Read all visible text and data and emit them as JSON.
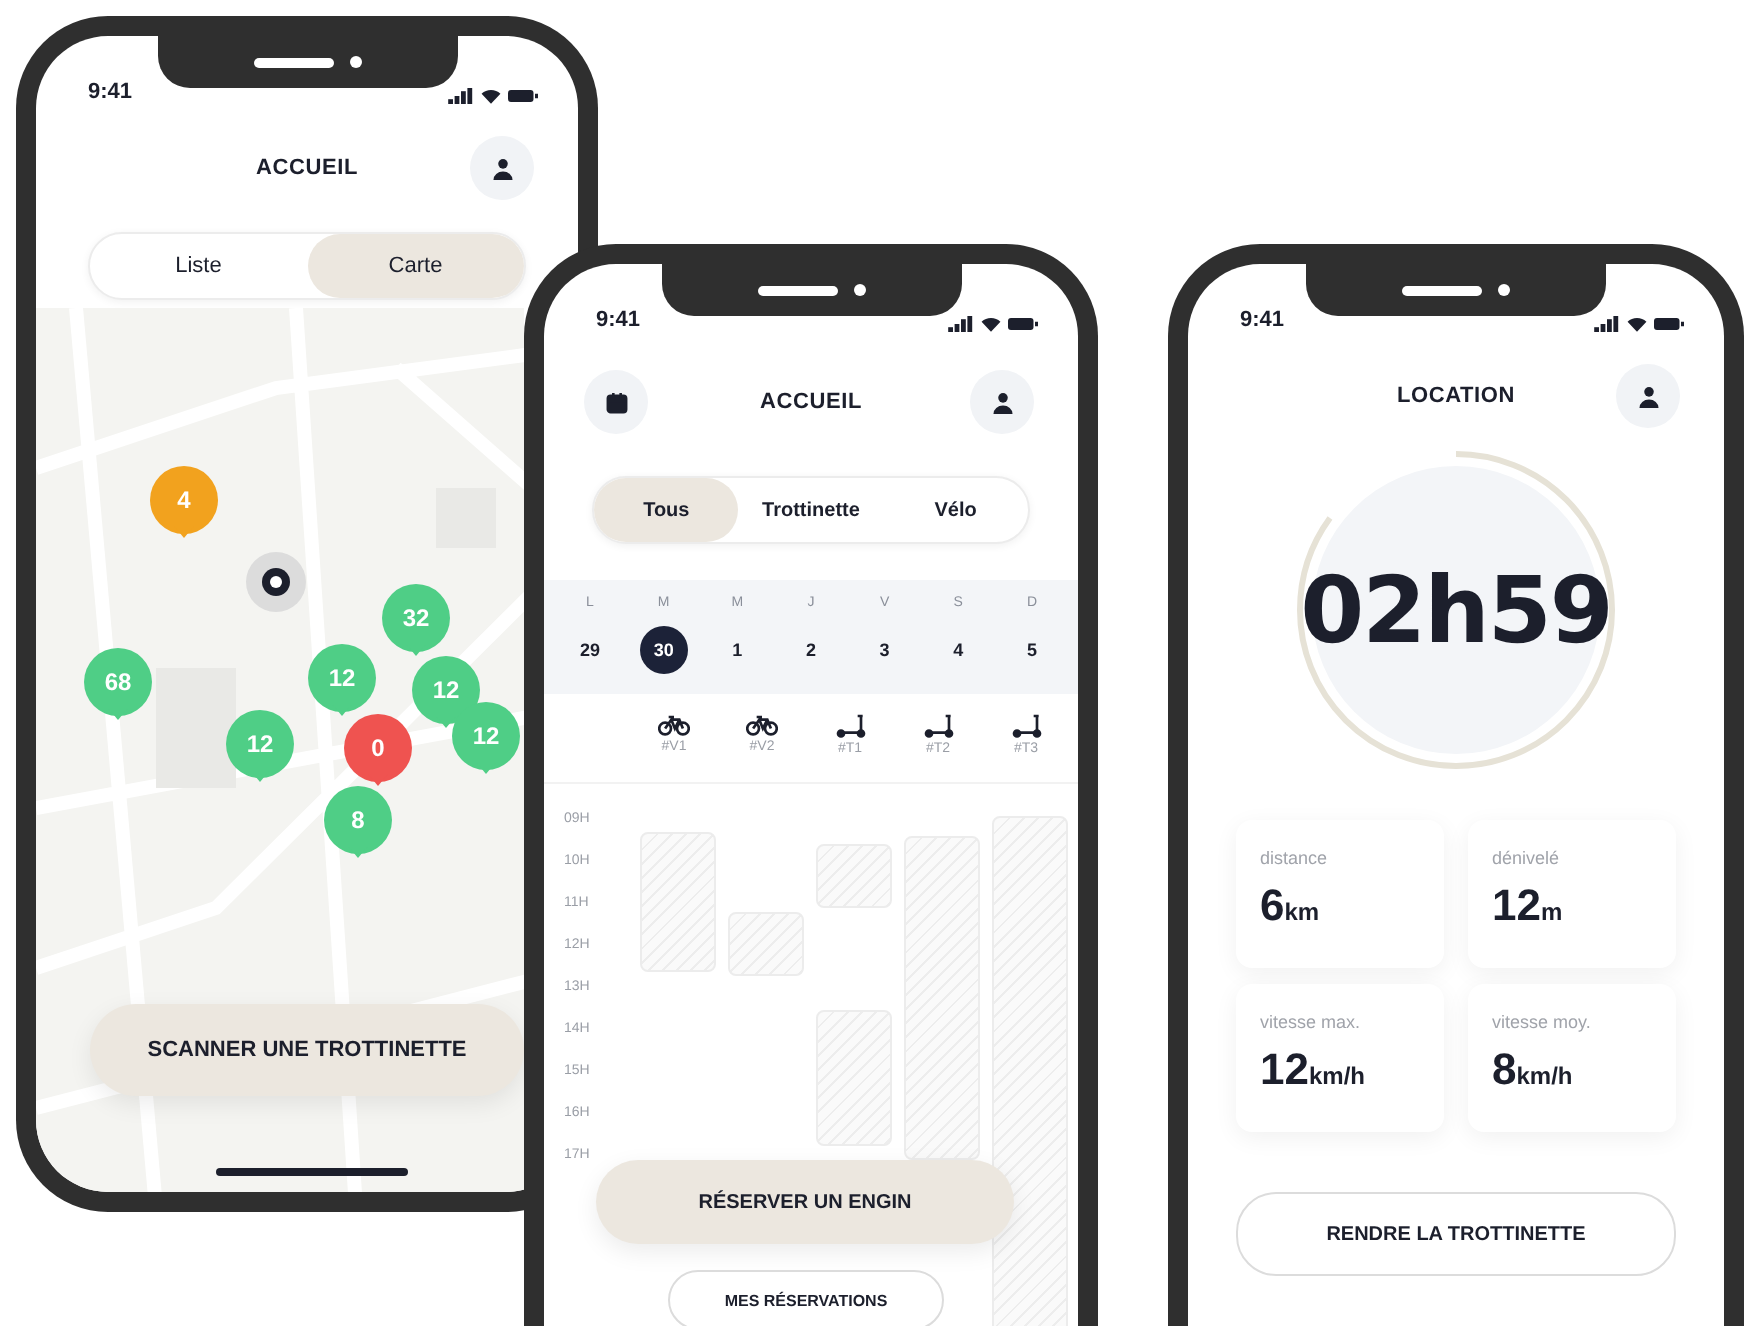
{
  "map_screen": {
    "status_time": "9:41",
    "title": "ACCUEIL",
    "view_tabs": [
      {
        "label": "Liste",
        "selected": false
      },
      {
        "label": "Carte",
        "selected": true
      }
    ],
    "pins": [
      {
        "count": "4",
        "color": "#f2a21e"
      },
      {
        "count": "32",
        "color": "#4fce86"
      },
      {
        "count": "68",
        "color": "#4fce86"
      },
      {
        "count": "12",
        "color": "#4fce86"
      },
      {
        "count": "12",
        "color": "#4fce86"
      },
      {
        "count": "12",
        "color": "#4fce86"
      },
      {
        "count": "0",
        "color": "#ef5350"
      },
      {
        "count": "12",
        "color": "#4fce86"
      },
      {
        "count": "8",
        "color": "#4fce86"
      }
    ],
    "scan_button": "SCANNER UNE TROTTINETTE"
  },
  "booking_screen": {
    "status_time": "9:41",
    "title": "ACCUEIL",
    "filter_tabs": [
      {
        "label": "Tous",
        "selected": true
      },
      {
        "label": "Trottinette",
        "selected": false
      },
      {
        "label": "Vélo",
        "selected": false
      }
    ],
    "days": [
      {
        "weekday": "L",
        "date": "29",
        "selected": false
      },
      {
        "weekday": "M",
        "date": "30",
        "selected": true
      },
      {
        "weekday": "M",
        "date": "1",
        "selected": false
      },
      {
        "weekday": "J",
        "date": "2",
        "selected": false
      },
      {
        "weekday": "V",
        "date": "3",
        "selected": false
      },
      {
        "weekday": "S",
        "date": "4",
        "selected": false
      },
      {
        "weekday": "D",
        "date": "5",
        "selected": false
      }
    ],
    "vehicles": [
      {
        "kind": "bike",
        "label": "#V1"
      },
      {
        "kind": "bike",
        "label": "#V2"
      },
      {
        "kind": "scooter",
        "label": "#T1"
      },
      {
        "kind": "scooter",
        "label": "#T2"
      },
      {
        "kind": "scooter",
        "label": "#T3"
      }
    ],
    "hours": [
      "09H",
      "10H",
      "11H",
      "12H",
      "13H",
      "14H",
      "15H",
      "16H",
      "17H"
    ],
    "reserve_button": "RÉSERVER UN ENGIN",
    "reservations_button": "MES RÉSERVATIONS"
  },
  "ride_screen": {
    "status_time": "9:41",
    "title": "LOCATION",
    "timer": {
      "text": "02h59",
      "level": 0.85
    },
    "stats": [
      {
        "label": "distance",
        "value": "6",
        "unit": "km"
      },
      {
        "label": "dénivelé",
        "value": "12",
        "unit": "m"
      },
      {
        "label": "vitesse max.",
        "value": "12",
        "unit": "km/h"
      },
      {
        "label": "vitesse moy.",
        "value": "8",
        "unit": "km/h"
      }
    ],
    "return_button": "RENDRE LA TROTTINETTE"
  }
}
